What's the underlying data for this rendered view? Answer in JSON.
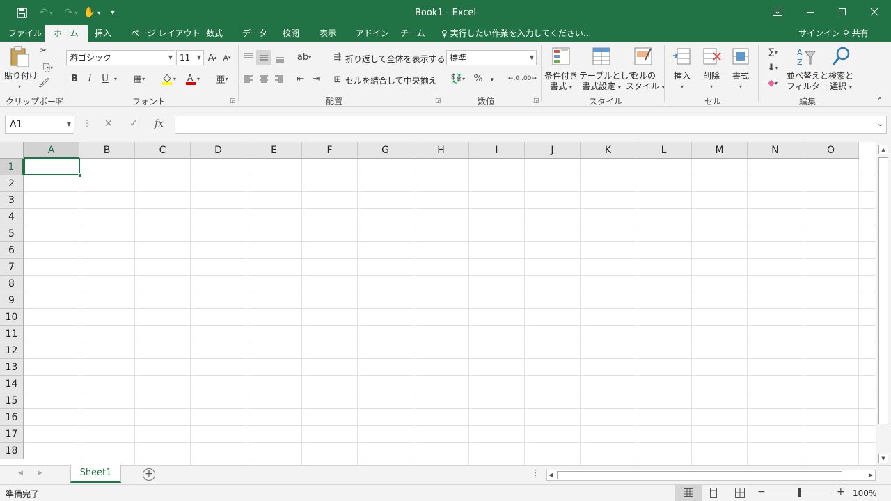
{
  "window": {
    "title": "Book1 - Excel",
    "accent": "#217346"
  },
  "tabs": [
    "ファイル",
    "ホーム",
    "挿入",
    "ページ レイアウト",
    "数式",
    "データ",
    "校閲",
    "表示",
    "アドイン",
    "チーム"
  ],
  "active_tab": "ホーム",
  "tell_me": "実行したい作業を入力してください...",
  "signin": "サインイン",
  "share": "共有",
  "ribbon": {
    "clipboard": {
      "paste": "貼り付け",
      "label": "クリップボード"
    },
    "font": {
      "name": "游ゴシック",
      "size": "11",
      "bold": "B",
      "italic": "I",
      "underline": "U",
      "label": "フォント"
    },
    "alignment": {
      "wrap": "折り返して全体を表示する",
      "merge": "セルを結合して中央揃え",
      "label": "配置"
    },
    "number": {
      "format": "標準",
      "percent": "%",
      "comma": ",",
      "label": "数値"
    },
    "styles": {
      "conditional_1": "条件付き",
      "conditional_2": "書式",
      "table_1": "テーブルとして",
      "table_2": "書式設定",
      "cell_1": "セルの",
      "cell_2": "スタイル",
      "label": "スタイル"
    },
    "cells": {
      "insert": "挿入",
      "delete": "削除",
      "format": "書式",
      "label": "セル"
    },
    "editing": {
      "sort_1": "並べ替えと",
      "sort_2": "フィルター",
      "find_1": "検索と",
      "find_2": "選択",
      "label": "編集"
    }
  },
  "formula_bar": {
    "name_box": "A1",
    "fx": "fx",
    "value": ""
  },
  "grid": {
    "columns": [
      "A",
      "B",
      "C",
      "D",
      "E",
      "F",
      "G",
      "H",
      "I",
      "J",
      "K",
      "L",
      "M",
      "N",
      "O"
    ],
    "rows": [
      "1",
      "2",
      "3",
      "4",
      "5",
      "6",
      "7",
      "8",
      "9",
      "10",
      "11",
      "12",
      "13",
      "14",
      "15",
      "16",
      "17",
      "18"
    ],
    "selected_cell": "A1"
  },
  "sheets": [
    "Sheet1"
  ],
  "status": {
    "ready": "準備完了",
    "zoom": "100%"
  }
}
